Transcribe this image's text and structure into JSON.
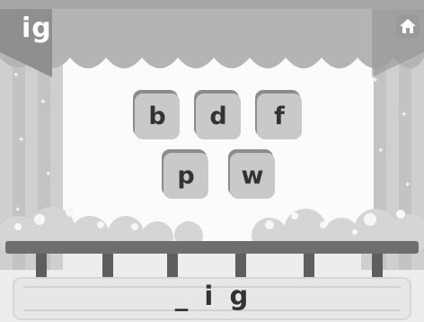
{
  "level": {
    "word_family": "ig"
  },
  "home_button": {
    "icon": "home-icon"
  },
  "letter_tiles": [
    {
      "letter": "b"
    },
    {
      "letter": "d"
    },
    {
      "letter": "f"
    },
    {
      "letter": "p"
    },
    {
      "letter": "w"
    }
  ],
  "answer": {
    "blank": "_",
    "letters": [
      "i",
      "g"
    ]
  },
  "colors": {
    "awning": "#b4b4b4",
    "tile_face": "#c9c9c9",
    "tile_shadow": "#8c8c8c",
    "fence": "#6e6e6e",
    "letter_text": "#333333"
  }
}
